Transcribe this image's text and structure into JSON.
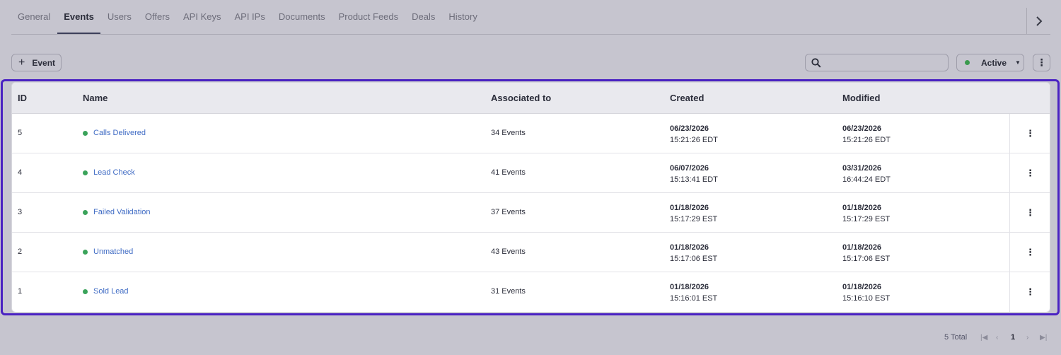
{
  "tabs": [
    "General",
    "Events",
    "Users",
    "Offers",
    "API Keys",
    "API IPs",
    "Documents",
    "Product Feeds",
    "Deals",
    "History"
  ],
  "active_tab": "Events",
  "toolbar": {
    "add_label": "Event",
    "search_value": "",
    "status_label": "Active"
  },
  "table": {
    "headers": {
      "id": "ID",
      "name": "Name",
      "associated": "Associated to",
      "created": "Created",
      "modified": "Modified"
    },
    "rows": [
      {
        "id": "5",
        "name": "Calls Delivered",
        "associated": "34 Events",
        "created_date": "06/23/2026",
        "created_time": "15:21:26 EDT",
        "modified_date": "06/23/2026",
        "modified_time": "15:21:26 EDT"
      },
      {
        "id": "4",
        "name": "Lead Check",
        "associated": "41 Events",
        "created_date": "06/07/2026",
        "created_time": "15:13:41 EDT",
        "modified_date": "03/31/2026",
        "modified_time": "16:44:24 EDT"
      },
      {
        "id": "3",
        "name": "Failed Validation",
        "associated": "37 Events",
        "created_date": "01/18/2026",
        "created_time": "15:17:29 EST",
        "modified_date": "01/18/2026",
        "modified_time": "15:17:29 EST"
      },
      {
        "id": "2",
        "name": "Unmatched",
        "associated": "43 Events",
        "created_date": "01/18/2026",
        "created_time": "15:17:06 EST",
        "modified_date": "01/18/2026",
        "modified_time": "15:17:06 EST"
      },
      {
        "id": "1",
        "name": "Sold Lead",
        "associated": "31 Events",
        "created_date": "01/18/2026",
        "created_time": "15:16:01 EST",
        "modified_date": "01/18/2026",
        "modified_time": "15:16:10 EST"
      }
    ]
  },
  "pagination": {
    "total": "5 Total",
    "page": "1"
  },
  "colors": {
    "status_active": "#3aa35a",
    "link": "#3f6bc4",
    "highlight": "#4a22c2"
  }
}
